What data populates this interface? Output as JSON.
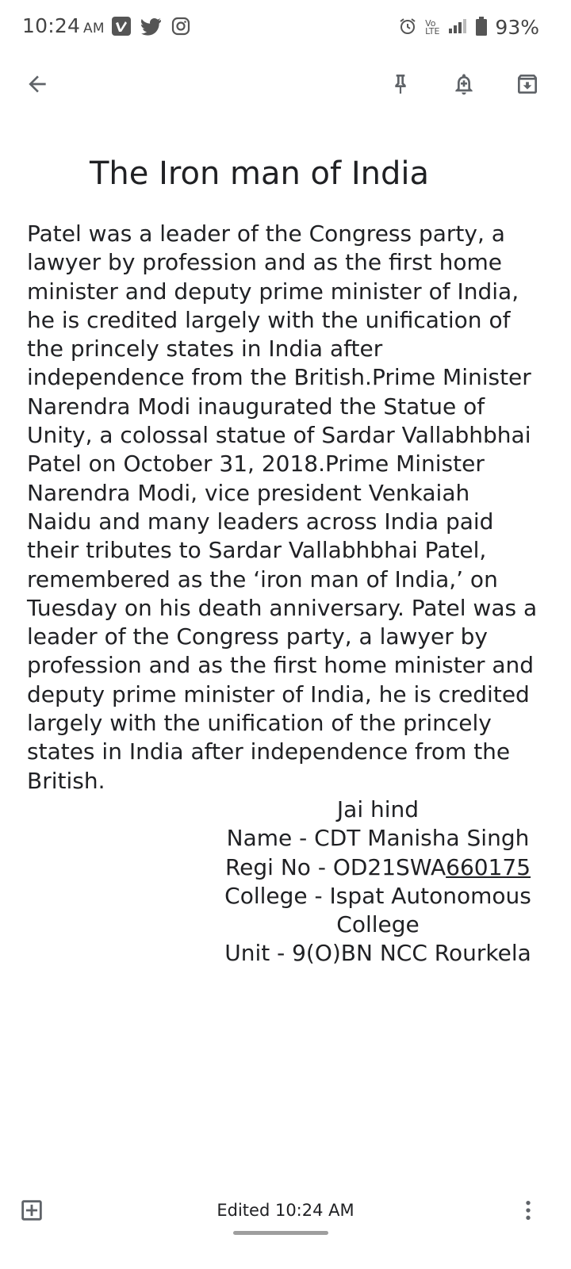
{
  "status_bar": {
    "time": "10:24",
    "ampm": "AM",
    "battery": "93%",
    "network_label_top": "Vo",
    "network_label_mid": "LTE",
    "network_label_bottom": "LTE",
    "notification_icons": [
      "vimeo-icon",
      "twitter-icon",
      "instagram-icon"
    ],
    "system_icons": [
      "alarm-icon",
      "signal-icon",
      "battery-icon"
    ]
  },
  "app_bar": {
    "back_icon": "arrow-back-icon",
    "actions": [
      "pin-icon",
      "reminder-icon",
      "archive-icon"
    ]
  },
  "note": {
    "title": "The Iron man of India",
    "body": "Patel was a leader of the Congress party, a lawyer by profession and as the first home minister and deputy prime minister of India, he is credited largely with the unification of the princely states in India after independence from the British.Prime Minister Narendra Modi inaugurated the Statue of Unity, a colossal statue of Sardar Vallabhbhai Patel on October 31, 2018.Prime Minister Narendra Modi, vice president Venkaiah Naidu and many leaders across India paid their tributes to Sardar Vallabhbhai Patel, remembered as the ‘iron man of India,’ on Tuesday on his death anniversary. Patel was a leader of the Congress party, a lawyer by profession and as the first home minister and deputy prime minister of India, he is credited largely with the unification of the princely states in India after independence from the British.",
    "signature": {
      "jai_hind": "Jai hind",
      "name": "Name - CDT Manisha Singh",
      "regi_prefix": "Regi No - OD21SWA",
      "regi_number": "660175",
      "college": "College - Ispat Autonomous College",
      "unit": "Unit - 9(O)BN NCC Rourkela"
    }
  },
  "bottom_bar": {
    "edited": "Edited 10:24 AM",
    "add_icon": "add-box-icon",
    "more_icon": "more-vert-icon"
  },
  "colors": {
    "text": "#202124",
    "icon": "#5f6368",
    "background": "#ffffff"
  }
}
